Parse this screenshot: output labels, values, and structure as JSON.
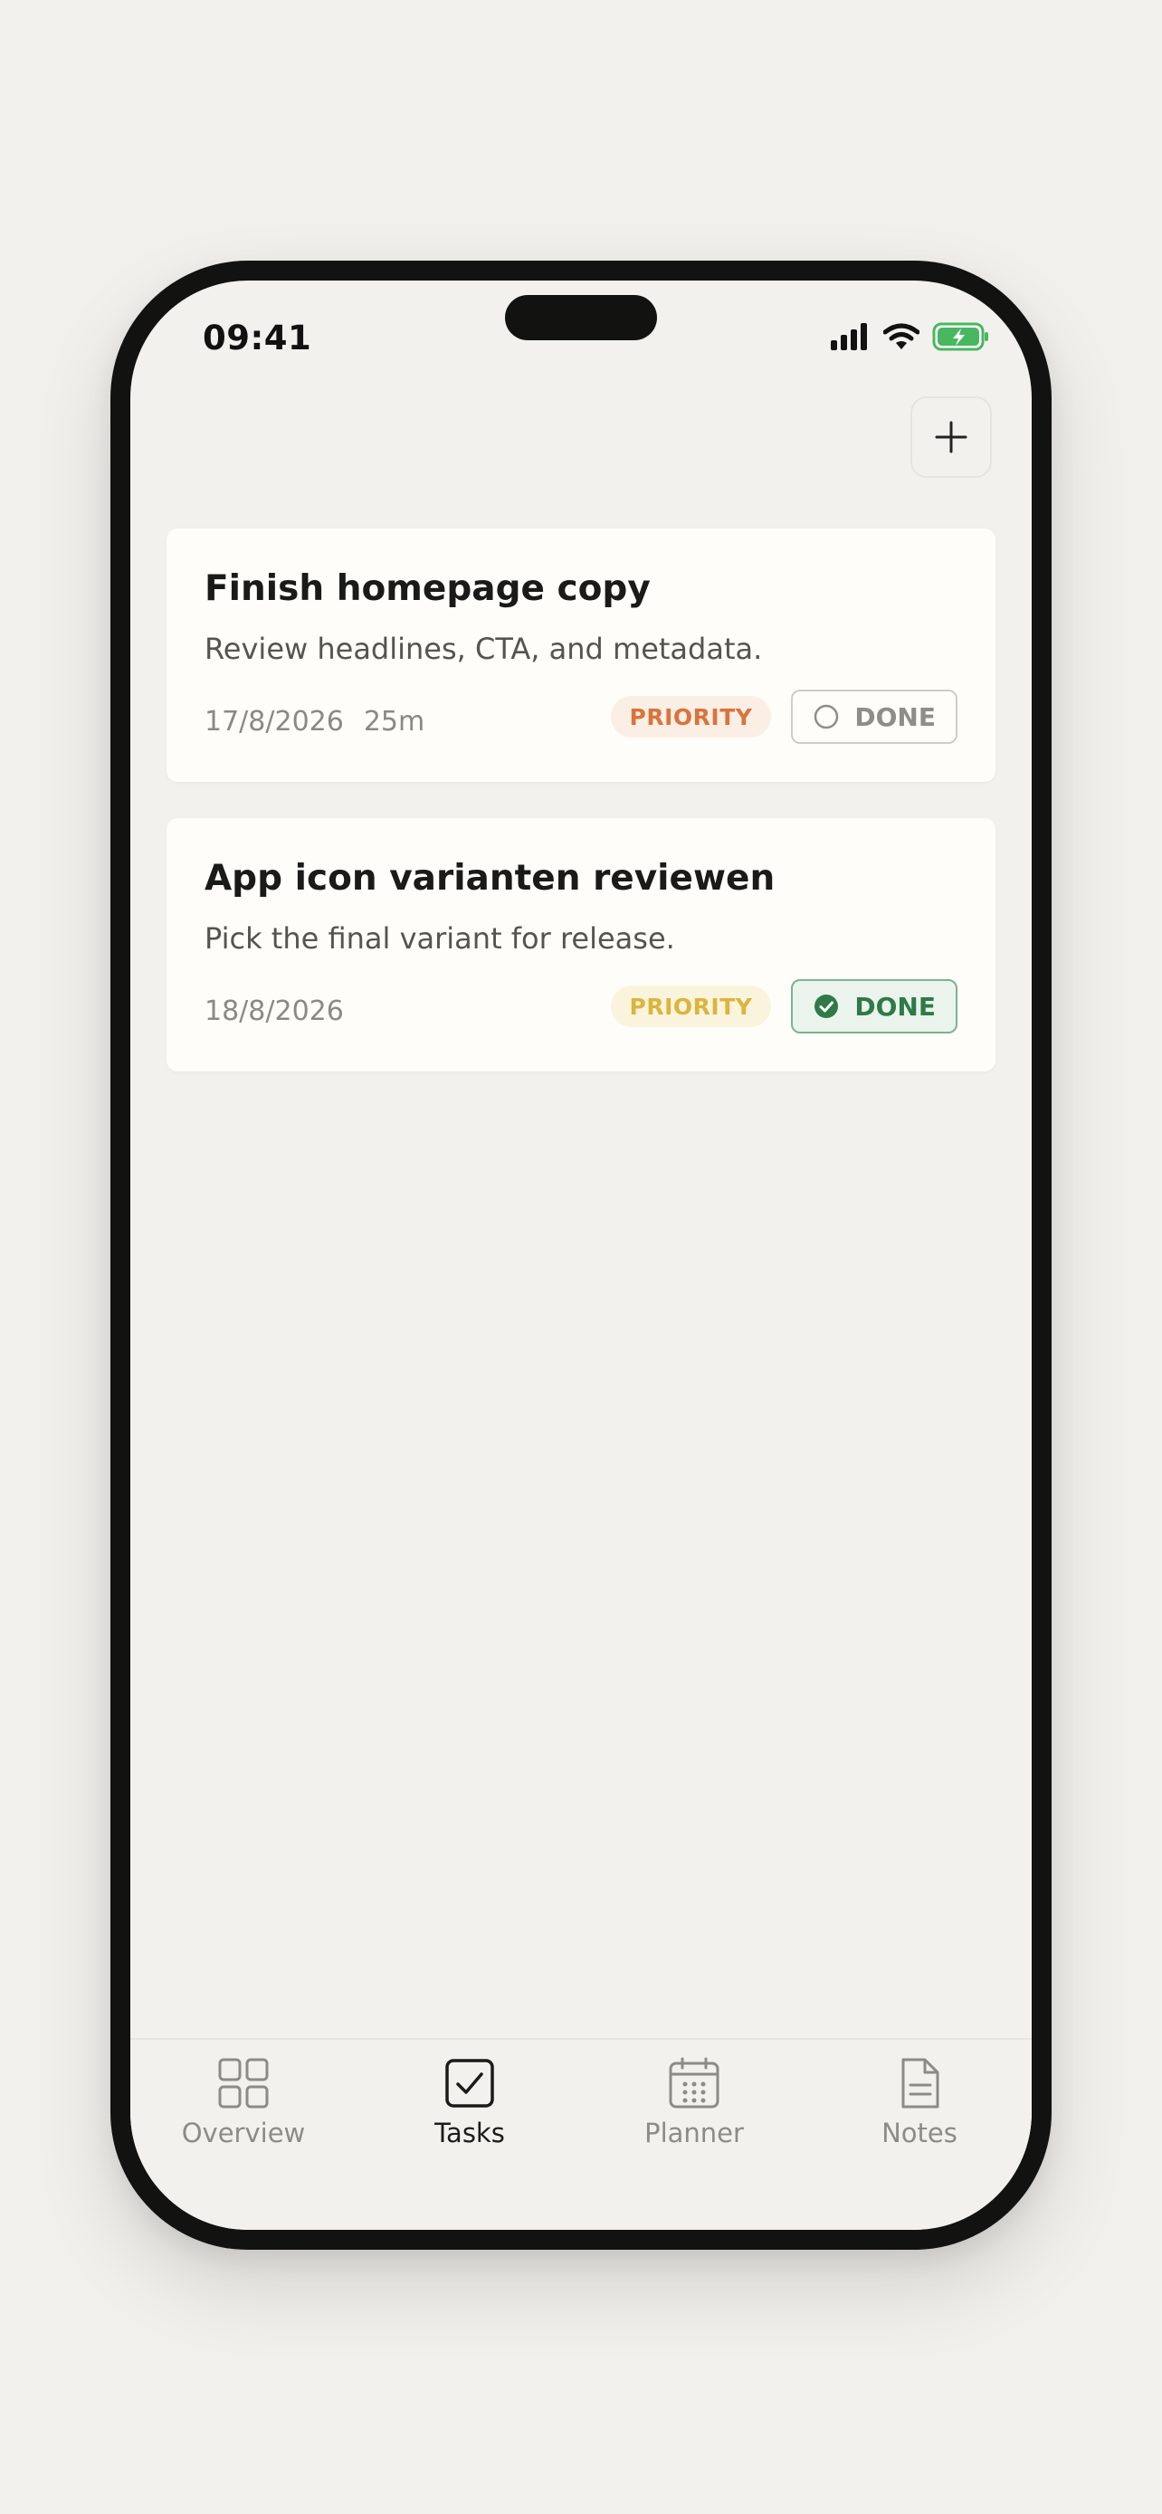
{
  "status_bar": {
    "time": "09:41"
  },
  "toolbar": {
    "add_icon": "plus-icon"
  },
  "tasks": [
    {
      "title": "Finish homepage copy",
      "description": "Review headlines, CTA, and metadata.",
      "date": "17/8/2026",
      "duration": "25m",
      "priority_label": "PRIORITY",
      "priority_color": "#d8743c",
      "done_label": "DONE",
      "done": false
    },
    {
      "title": "App icon varianten reviewen",
      "description": "Pick the final variant for release.",
      "date": "18/8/2026",
      "duration": "",
      "priority_label": "PRIORITY",
      "priority_color": "#dcb43e",
      "done_label": "DONE",
      "done": true
    }
  ],
  "tabbar": {
    "tabs": [
      {
        "label": "Overview",
        "icon": "grid-icon",
        "active": false
      },
      {
        "label": "Tasks",
        "icon": "checkbox-icon",
        "active": true
      },
      {
        "label": "Planner",
        "icon": "calendar-icon",
        "active": false
      },
      {
        "label": "Notes",
        "icon": "document-icon",
        "active": false
      }
    ]
  },
  "colors": {
    "background": "#f2f1ed",
    "card": "#fefdf9",
    "done_green": "#2f7a47"
  }
}
